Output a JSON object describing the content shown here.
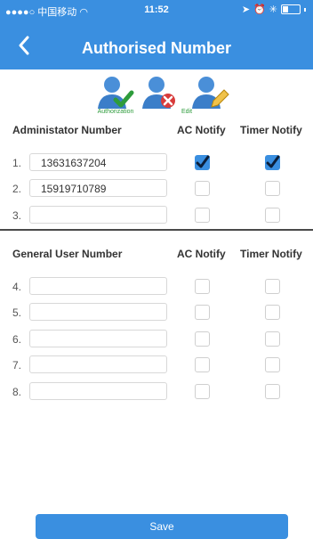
{
  "status_bar": {
    "carrier": "●●●●○ 中国移动 ",
    "time": "11:52"
  },
  "header": {
    "title": "Authorised Number"
  },
  "toolbar": {
    "authorization_label": "Authorization",
    "edit_label": "Edit"
  },
  "admin_section": {
    "heading": "Administator Number",
    "ac_heading": "AC Notify",
    "timer_heading": "Timer Notify",
    "rows": [
      {
        "index": "1.",
        "number": "13631637204",
        "ac": true,
        "timer": true
      },
      {
        "index": "2.",
        "number": "15919710789",
        "ac": false,
        "timer": false
      },
      {
        "index": "3.",
        "number": "",
        "ac": false,
        "timer": false
      }
    ]
  },
  "general_section": {
    "heading": "General User Number",
    "ac_heading": "AC Notify",
    "timer_heading": "Timer Notify",
    "rows": [
      {
        "index": "4.",
        "number": "",
        "ac": false,
        "timer": false
      },
      {
        "index": "5.",
        "number": "",
        "ac": false,
        "timer": false
      },
      {
        "index": "6.",
        "number": "",
        "ac": false,
        "timer": false
      },
      {
        "index": "7.",
        "number": "",
        "ac": false,
        "timer": false
      },
      {
        "index": "8.",
        "number": "",
        "ac": false,
        "timer": false
      }
    ]
  },
  "save_label": "Save",
  "colors": {
    "accent": "#3a8fe0",
    "authorization_green": "#2e9c3c"
  }
}
